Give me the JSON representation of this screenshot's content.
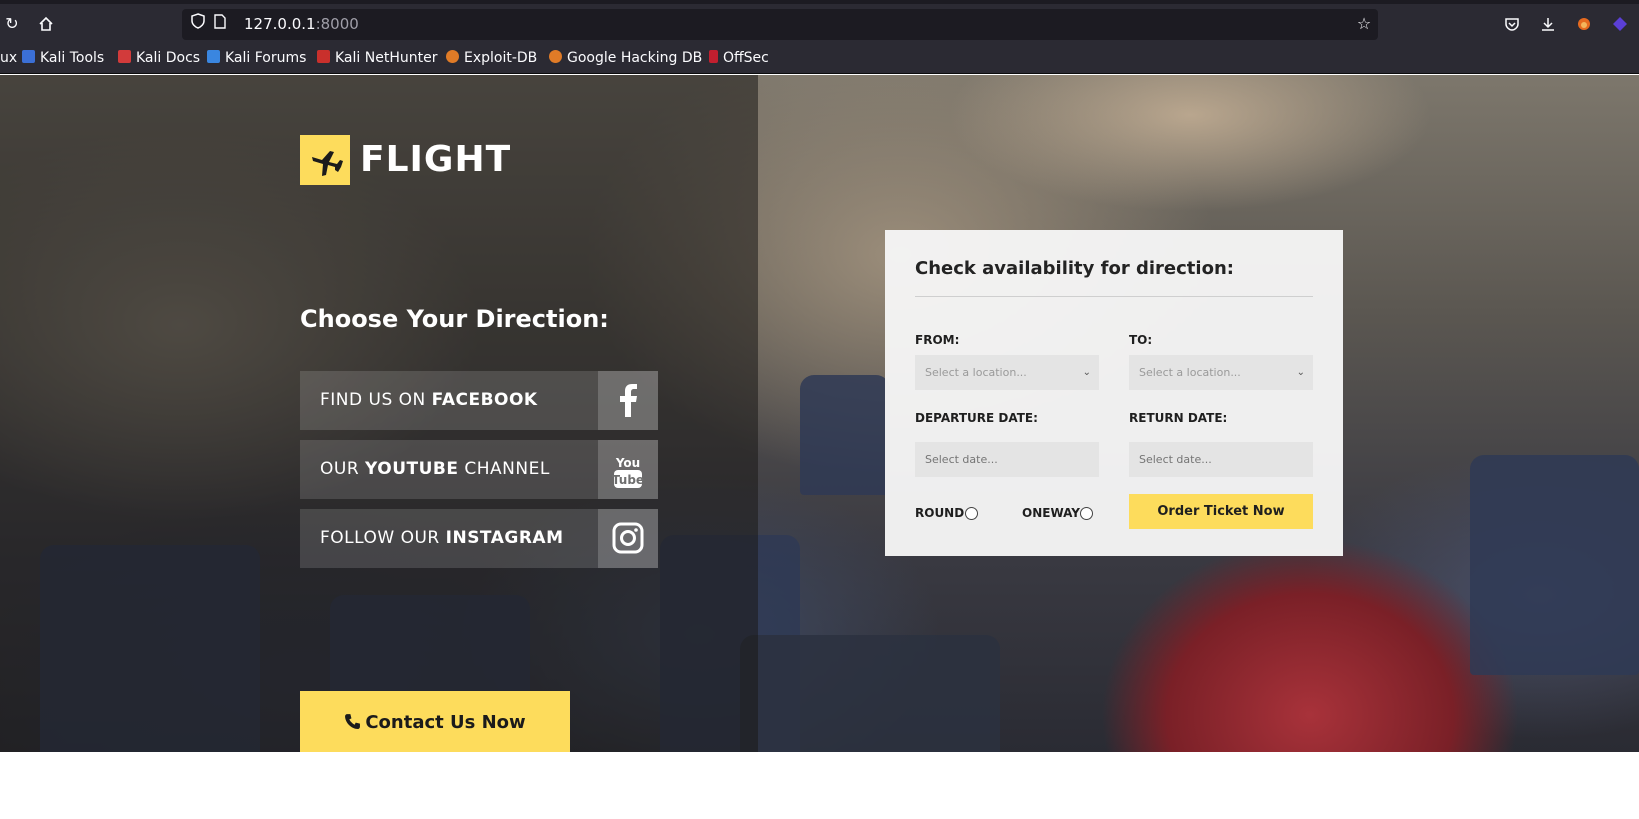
{
  "browser": {
    "url_host": "127.0.0.1",
    "url_port": ":8000",
    "bookmarks": [
      {
        "label": "ux"
      },
      {
        "label": "Kali Tools"
      },
      {
        "label": "Kali Docs"
      },
      {
        "label": "Kali Forums"
      },
      {
        "label": "Kali NetHunter"
      },
      {
        "label": "Exploit-DB"
      },
      {
        "label": "Google Hacking DB"
      },
      {
        "label": "OffSec"
      }
    ]
  },
  "brand": {
    "name": "FLIGHT",
    "accent": "#fddc5c"
  },
  "left": {
    "heading": "Choose Your Direction:",
    "social": [
      {
        "prefix": "FIND US ON ",
        "bold": "FACEBOOK",
        "suffix": "",
        "icon": "facebook-icon"
      },
      {
        "prefix": "OUR ",
        "bold": "YOUTUBE",
        "suffix": " CHANNEL",
        "icon": "youtube-icon"
      },
      {
        "prefix": "FOLLOW OUR ",
        "bold": "INSTAGRAM",
        "suffix": "",
        "icon": "instagram-icon"
      }
    ],
    "contact_label": "Contact Us Now",
    "contact_icon": "phone-icon"
  },
  "form": {
    "title": "Check availability for direction:",
    "from_label": "FROM:",
    "to_label": "TO:",
    "from_placeholder": "Select a location...",
    "to_placeholder": "Select a location...",
    "departure_label": "DEPARTURE DATE:",
    "return_label": "RETURN DATE:",
    "departure_placeholder": "Select date...",
    "return_placeholder": "Select date...",
    "round_label": "ROUND",
    "oneway_label": "ONEWAY",
    "order_label": "Order Ticket Now"
  }
}
